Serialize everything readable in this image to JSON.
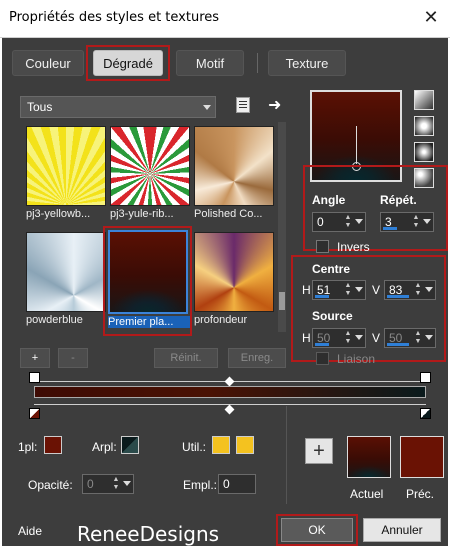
{
  "window": {
    "title": "Propriétés des styles et textures",
    "close_glyph": "✕"
  },
  "tabs": [
    {
      "label": "Couleur",
      "active": false
    },
    {
      "label": "Dégradé",
      "active": true
    },
    {
      "label": "Motif",
      "active": false
    },
    {
      "label": "Texture",
      "active": false
    }
  ],
  "library": {
    "filter": "Tous",
    "thumbnails": [
      {
        "label": "pj3-yellowb...",
        "selected": false
      },
      {
        "label": "pj3-yule-rib...",
        "selected": false
      },
      {
        "label": "Polished Co...",
        "selected": false
      },
      {
        "label": "powderblue",
        "selected": false
      },
      {
        "label": "Premier pla...",
        "selected": true
      },
      {
        "label": "profondeur",
        "selected": false
      }
    ],
    "add_label": "+",
    "remove_label": "-",
    "reset_label": "Réinit.",
    "save_label": "Enreg."
  },
  "params": {
    "angle_label": "Angle",
    "angle_value": "0",
    "repeat_label": "Répét.",
    "repeat_value": "3",
    "invert_label": "Invers",
    "center_label": "Centre",
    "center_h_label": "H",
    "center_h": "51",
    "center_v_label": "V",
    "center_v": "83",
    "source_label": "Source",
    "source_h_label": "H",
    "source_h": "50",
    "source_v_label": "V",
    "source_v": "50",
    "link_label": "Liaison"
  },
  "editor": {
    "first_plan_label": "1pl:",
    "arpl_label": "Arpl:",
    "util_label": "Util.:",
    "opacity_label": "Opacité:",
    "opacity_value": "0",
    "empl_label": "Empl.:",
    "empl_value": "0",
    "add_label": "+",
    "current_label": "Actuel",
    "previous_label": "Préc."
  },
  "footer": {
    "help_label": "Aide",
    "watermark": "ReneeDesigns",
    "ok_label": "OK",
    "cancel_label": "Annuler"
  },
  "colors": {
    "dialog_bg": "#3d3d3d",
    "accent_blue": "#2f7fd6",
    "highlight_red": "#b21a1a",
    "fg_color": "#6a1204",
    "util_yellow": "#f4c21f"
  }
}
